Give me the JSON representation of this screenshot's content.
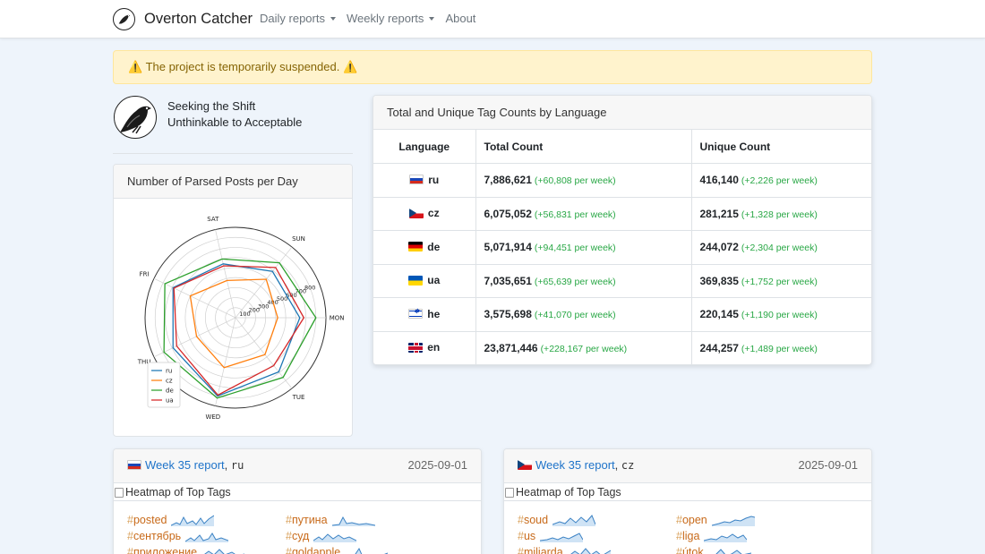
{
  "navbar": {
    "brand": "Overton Catcher",
    "links": [
      {
        "label": "Daily reports",
        "dropdown": true
      },
      {
        "label": "Weekly reports",
        "dropdown": true
      },
      {
        "label": "About",
        "dropdown": false
      }
    ]
  },
  "alert": {
    "text": "⚠️ The project is temporarily suspended. ⚠️"
  },
  "hero": {
    "line1": "Seeking the Shift",
    "line2": "Unthinkable to Acceptable"
  },
  "posts_card": {
    "title": "Number of Parsed Posts per Day"
  },
  "chart_data": {
    "type": "radar",
    "axes": [
      "MON",
      "TUE",
      "WED",
      "THU",
      "FRI",
      "SAT",
      "SUN"
    ],
    "radial_ticks": [
      "100",
      "200",
      "300",
      "400",
      "500",
      "600",
      "700",
      "800"
    ],
    "rlim": [
      0,
      900
    ],
    "series": [
      {
        "name": "ru",
        "color": "#1f77b4",
        "values": [
          640,
          690,
          800,
          690,
          690,
          550,
          590
        ]
      },
      {
        "name": "cz",
        "color": "#ff7f0e",
        "values": [
          420,
          470,
          510,
          430,
          500,
          380,
          490
        ]
      },
      {
        "name": "de",
        "color": "#2ca02c",
        "values": [
          800,
          760,
          820,
          790,
          780,
          600,
          700
        ]
      },
      {
        "name": "ua",
        "color": "#d62728",
        "values": [
          680,
          610,
          790,
          650,
          680,
          530,
          640
        ]
      }
    ],
    "legend_position": "lower-left"
  },
  "tags_card": {
    "title": "Total and Unique Tag Counts by Language",
    "headers": [
      "Language",
      "Total Count",
      "Unique Count"
    ],
    "rows": [
      {
        "flag": "ru",
        "lang": "ru",
        "total": "7,886,621",
        "total_delta": "(+60,808 per week)",
        "unique": "416,140",
        "unique_delta": "(+2,226 per week)"
      },
      {
        "flag": "cz",
        "lang": "cz",
        "total": "6,075,052",
        "total_delta": "(+56,831 per week)",
        "unique": "281,215",
        "unique_delta": "(+1,328 per week)"
      },
      {
        "flag": "de",
        "lang": "de",
        "total": "5,071,914",
        "total_delta": "(+94,451 per week)",
        "unique": "244,072",
        "unique_delta": "(+2,304 per week)"
      },
      {
        "flag": "ua",
        "lang": "ua",
        "total": "7,035,651",
        "total_delta": "(+65,639 per week)",
        "unique": "369,835",
        "unique_delta": "(+1,752 per week)"
      },
      {
        "flag": "he",
        "lang": "he",
        "total": "3,575,698",
        "total_delta": "(+41,070 per week)",
        "unique": "220,145",
        "unique_delta": "(+1,190 per week)"
      },
      {
        "flag": "en",
        "lang": "en",
        "total": "23,871,446",
        "total_delta": "(+228,167 per week)",
        "unique": "244,257",
        "unique_delta": "(+1,489 per week)"
      }
    ]
  },
  "weekly": [
    {
      "link": "Week 35 report",
      "sep": ", ",
      "code": "ru",
      "date": "2025-09-01",
      "heatmap_alt": "Heatmap of Top Tags",
      "tags": [
        {
          "hash": "#",
          "name": "posted"
        },
        {
          "hash": "#",
          "name": "путина"
        },
        {
          "hash": "#",
          "name": "сентябрь"
        },
        {
          "hash": "#",
          "name": "суд"
        },
        {
          "hash": "#",
          "name": "приложение"
        },
        {
          "hash": "#",
          "name": "goldapple"
        }
      ]
    },
    {
      "link": "Week 35 report",
      "sep": ", ",
      "code": "cz",
      "date": "2025-09-01",
      "heatmap_alt": "Heatmap of Top Tags",
      "tags": [
        {
          "hash": "#",
          "name": "soud"
        },
        {
          "hash": "#",
          "name": "open"
        },
        {
          "hash": "#",
          "name": "us"
        },
        {
          "hash": "#",
          "name": "liga"
        },
        {
          "hash": "#",
          "name": "miliarda"
        },
        {
          "hash": "#",
          "name": "útok"
        }
      ]
    }
  ]
}
